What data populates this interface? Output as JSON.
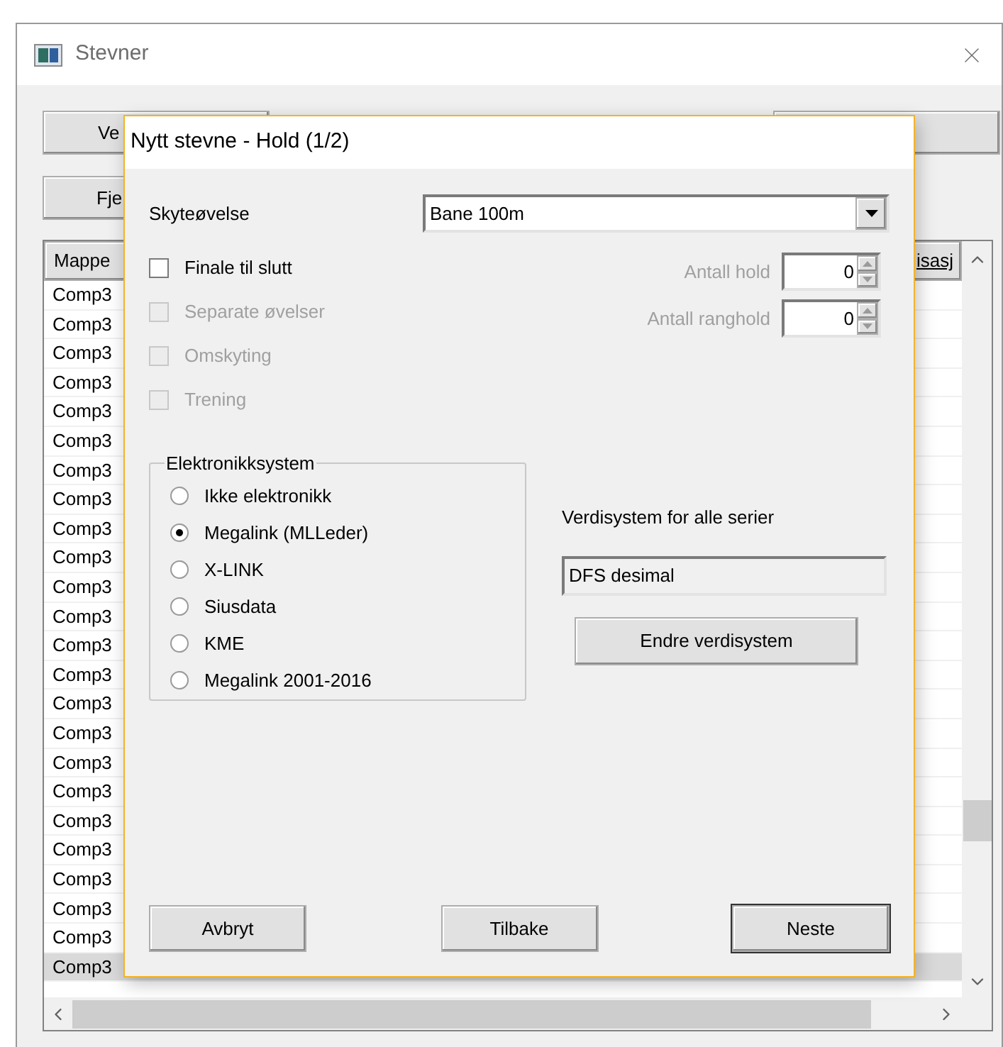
{
  "window": {
    "title": "Stevner"
  },
  "background_buttons": [
    {
      "label": "Ve"
    },
    {
      "label": "Fje"
    }
  ],
  "list": {
    "columns": [
      "Mappe",
      "isasj"
    ],
    "rows": [
      {
        "text": "Comp3",
        "selected": false
      },
      {
        "text": "Comp3",
        "selected": false
      },
      {
        "text": "Comp3",
        "selected": false
      },
      {
        "text": "Comp3",
        "selected": false
      },
      {
        "text": "Comp3",
        "selected": false
      },
      {
        "text": "Comp3",
        "selected": false
      },
      {
        "text": "Comp3",
        "selected": false
      },
      {
        "text": "Comp3",
        "selected": false
      },
      {
        "text": "Comp3",
        "selected": false
      },
      {
        "text": "Comp3",
        "selected": false
      },
      {
        "text": "Comp3",
        "selected": false
      },
      {
        "text": "Comp3",
        "selected": false
      },
      {
        "text": "Comp3",
        "selected": false
      },
      {
        "text": "Comp3",
        "selected": false
      },
      {
        "text": "Comp3",
        "selected": false
      },
      {
        "text": "Comp3",
        "selected": false
      },
      {
        "text": "Comp3",
        "selected": false
      },
      {
        "text": "Comp3",
        "selected": false
      },
      {
        "text": "Comp3",
        "selected": false
      },
      {
        "text": "Comp3",
        "selected": false
      },
      {
        "text": "Comp3",
        "selected": false
      },
      {
        "text": "Comp3",
        "selected": false
      },
      {
        "text": "Comp3",
        "selected": false
      },
      {
        "text": "Comp3",
        "selected": true
      }
    ]
  },
  "dialog": {
    "title": "Nytt stevne - Hold (1/2)",
    "exercise": {
      "label": "Skyteøvelse",
      "value": "Bane 100m"
    },
    "checkboxes": [
      {
        "label": "Finale til slutt",
        "checked": false,
        "disabled": false
      },
      {
        "label": "Separate øvelser",
        "checked": false,
        "disabled": true
      },
      {
        "label": "Omskyting",
        "checked": false,
        "disabled": true
      },
      {
        "label": "Trening",
        "checked": false,
        "disabled": true
      }
    ],
    "spinners": [
      {
        "label": "Antall hold",
        "value": "0",
        "disabled": true
      },
      {
        "label": "Antall ranghold",
        "value": "0",
        "disabled": true
      }
    ],
    "electronics": {
      "title": "Elektronikksystem",
      "options": [
        {
          "label": "Ikke elektronikk",
          "selected": false
        },
        {
          "label": "Megalink (MLLeder)",
          "selected": true
        },
        {
          "label": "X-LINK",
          "selected": false
        },
        {
          "label": "Siusdata",
          "selected": false
        },
        {
          "label": "KME",
          "selected": false
        },
        {
          "label": "Megalink 2001-2016",
          "selected": false
        }
      ]
    },
    "value_system": {
      "label": "Verdisystem for alle serier",
      "value": "DFS desimal",
      "button": "Endre verdisystem"
    },
    "buttons": [
      {
        "label": "Avbryt",
        "default": false
      },
      {
        "label": "Tilbake",
        "default": false
      },
      {
        "label": "Neste",
        "default": true
      }
    ]
  }
}
